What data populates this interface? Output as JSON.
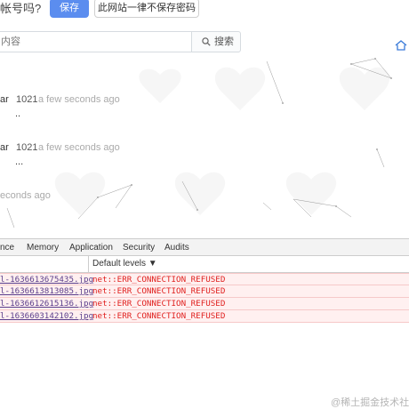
{
  "password_bar": {
    "prompt": "帐号吗?",
    "save_label": "保存",
    "never_label": "此网站一律不保存密码"
  },
  "search": {
    "placeholder": "内容",
    "button_label": "搜索",
    "search_icon": "search-icon",
    "home_icon": "home-icon"
  },
  "comments": [
    {
      "author": "ar",
      "number": "1021",
      "time": "a few seconds ago",
      "text": ".."
    },
    {
      "author": "ar",
      "number": "1021",
      "time": "a few seconds ago",
      "text": "..."
    }
  ],
  "orphan_time": "econds ago",
  "devtools": {
    "tabs": [
      "nce",
      "Memory",
      "Application",
      "Security",
      "Audits"
    ],
    "levels_label": "Default levels ▼",
    "errors": [
      {
        "source": "l-1636613675435.jpg",
        "message": "net::ERR_CONNECTION_REFUSED"
      },
      {
        "source": "l-1636613813085.jpg",
        "message": "net::ERR_CONNECTION_REFUSED"
      },
      {
        "source": "l-1636612615136.jpg",
        "message": "net::ERR_CONNECTION_REFUSED"
      },
      {
        "source": "l-1636603142102.jpg",
        "message": "net::ERR_CONNECTION_REFUSED"
      }
    ]
  },
  "watermark": "@稀土掘金技术社区",
  "colors": {
    "save_button": "#5b8def",
    "error_text": "#e0211f",
    "error_row_bg": "#fff0f0",
    "source_link": "#5a3e8c"
  }
}
